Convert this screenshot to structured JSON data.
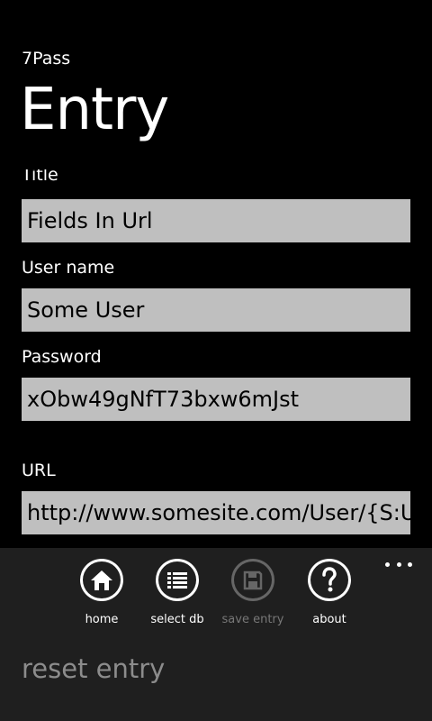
{
  "header": {
    "app_title": "7Pass",
    "page_title": "Entry"
  },
  "form": {
    "title_label": "Title",
    "title_value": "Fields In Url",
    "username_label": "User name",
    "username_value": "Some User",
    "password_label": "Password",
    "password_value": "xObw49gNfT73bxw6mJst",
    "url_label": "URL",
    "url_value": "http://www.somesite.com/User/{S:UserName}"
  },
  "app_bar": {
    "home_label": "home",
    "select_db_label": "select db",
    "save_entry_label": "save entry",
    "about_label": "about",
    "save_entry_enabled": false,
    "menu": {
      "reset_entry": "reset entry"
    }
  },
  "colors": {
    "background": "#000000",
    "text_box": "#bfbfbf",
    "app_bar": "#1f1f1f",
    "disabled": "#777777",
    "menu_text": "#8c8c8c"
  }
}
